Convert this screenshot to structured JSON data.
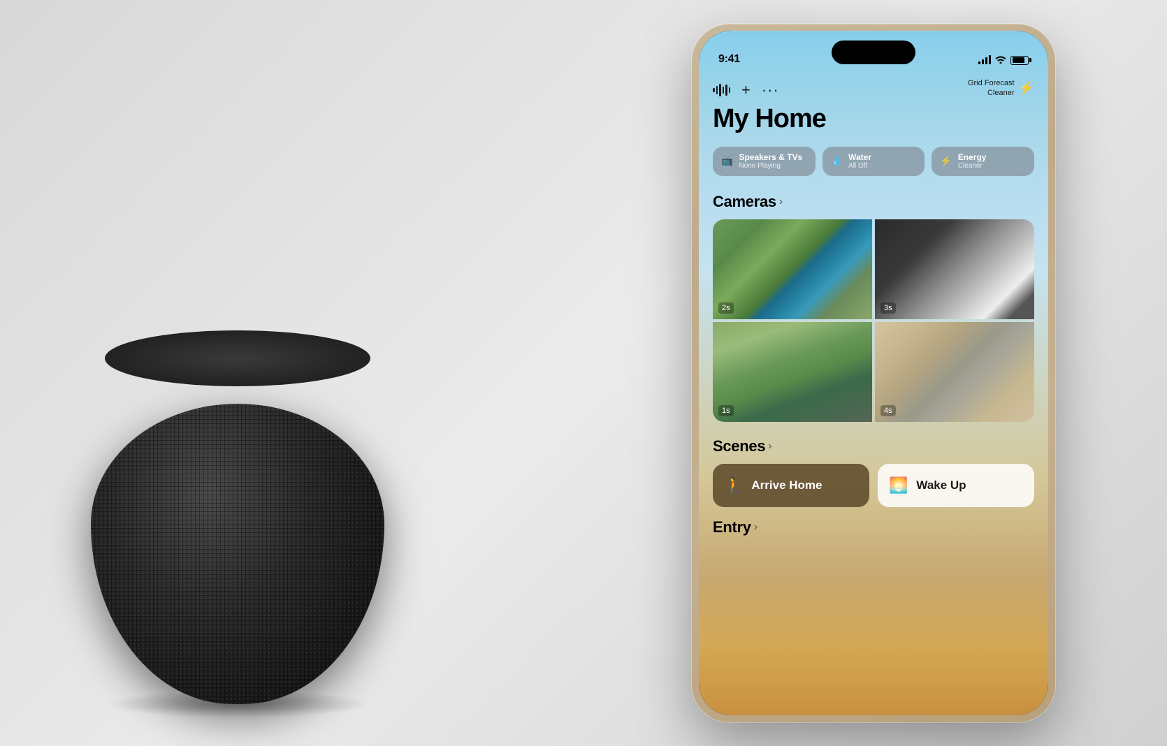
{
  "scene": {
    "background": "#e8e8e8"
  },
  "status_bar": {
    "time": "9:41",
    "signal_label": "signal",
    "wifi_label": "wifi",
    "battery_label": "battery"
  },
  "header": {
    "title": "My Home",
    "icons": {
      "waveform": "waveform",
      "add": "+",
      "more": "···"
    },
    "grid_forecast": {
      "line1": "Grid Forecast",
      "line2": "Cleaner",
      "icon": "⚡"
    }
  },
  "chips": [
    {
      "icon": "🖥",
      "label": "Speakers & TVs",
      "sublabel": "None Playing"
    },
    {
      "icon": "💧",
      "label": "Water",
      "sublabel": "All Off"
    },
    {
      "icon": "⚡",
      "label": "Energy",
      "sublabel": "Cleaner"
    }
  ],
  "cameras": {
    "section_title": "Cameras",
    "chevron": "›",
    "cells": [
      {
        "timer": "2s",
        "type": "pool"
      },
      {
        "timer": "3s",
        "type": "gym"
      },
      {
        "timer": "1s",
        "type": "yard"
      },
      {
        "timer": "4s",
        "type": "living"
      }
    ]
  },
  "scenes": {
    "section_title": "Scenes",
    "chevron": "›",
    "buttons": [
      {
        "icon": "🚶",
        "label": "Arrive Home",
        "style": "dark"
      },
      {
        "icon": "🌅",
        "label": "Wake Up",
        "style": "light"
      }
    ]
  },
  "entry": {
    "section_title": "Entry",
    "chevron": "›"
  }
}
